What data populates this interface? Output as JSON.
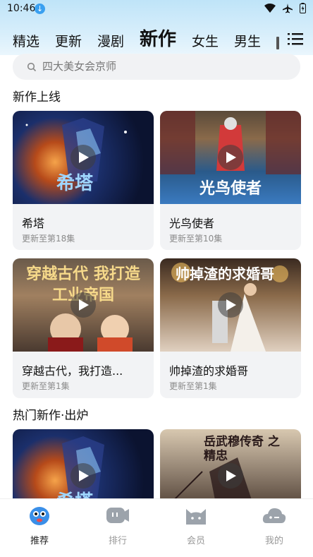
{
  "status_bar": {
    "time": "10:46"
  },
  "tabs": [
    {
      "label": "精选",
      "active": false
    },
    {
      "label": "更新",
      "active": false
    },
    {
      "label": "漫剧",
      "active": false
    },
    {
      "label": "新作",
      "active": true
    },
    {
      "label": "女生",
      "active": false
    },
    {
      "label": "男生",
      "active": false
    }
  ],
  "search": {
    "placeholder": "四大美女会京师"
  },
  "sections": [
    {
      "title": "新作上线",
      "cards": [
        {
          "title": "希塔",
          "subtitle": "更新至第18集",
          "poster_text": "希塔"
        },
        {
          "title": "光鸟使者",
          "subtitle": "更新至第10集",
          "poster_text": "光鸟使者"
        },
        {
          "title": "穿越古代，我打造...",
          "subtitle": "更新至第1集",
          "poster_text": "穿越古代 我打造工业帝国"
        },
        {
          "title": "帅掉渣的求婚哥",
          "subtitle": "更新至第1集",
          "poster_text": "帅掉渣的求婚哥"
        }
      ]
    },
    {
      "title": "热门新作·出炉",
      "cards": [
        {
          "title": "",
          "subtitle": "",
          "poster_text": "希塔"
        },
        {
          "title": "",
          "subtitle": "",
          "poster_text": "岳武穆传奇 之精忠"
        }
      ]
    }
  ],
  "bottom_nav": [
    {
      "label": "推荐",
      "icon": "recommend-mascot-icon",
      "active": true
    },
    {
      "label": "排行",
      "icon": "ranking-icon",
      "active": false
    },
    {
      "label": "会员",
      "icon": "vip-cat-icon",
      "active": false
    },
    {
      "label": "我的",
      "icon": "profile-cloud-icon",
      "active": false
    }
  ],
  "colors": {
    "header_top": "#bfe4f8",
    "card_bg": "#f2f3f5",
    "accent_blue": "#3aa0f0"
  }
}
